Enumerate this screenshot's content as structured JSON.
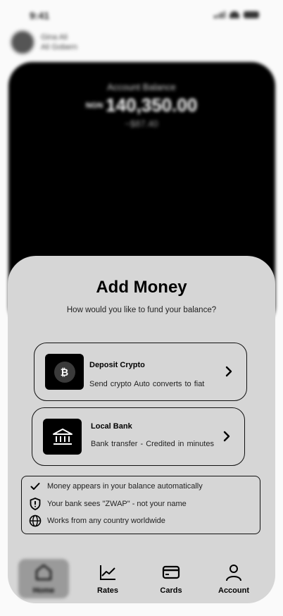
{
  "status": {
    "time": "9:41"
  },
  "user": {
    "line1": "Gina Ali",
    "line2": "Ali Gobern"
  },
  "balance": {
    "label": "Account Balance",
    "currency": "NGN",
    "amount": "140,350.00",
    "usd": "~$87.40"
  },
  "sheet": {
    "title": "Add Money",
    "subtitle": "How would you like to fund your balance?",
    "options": [
      {
        "title": "Deposit Crypto",
        "description": "Send crypto  Auto converts to fiat",
        "icon": "bitcoin-icon"
      },
      {
        "title": "Local Bank",
        "description": "Bank transfer - Credited in minutes",
        "icon": "bank-icon"
      }
    ],
    "info": [
      {
        "icon": "check-icon",
        "text": "Money appears in your balance automatically"
      },
      {
        "icon": "shield-icon",
        "text": "Your bank sees \"ZWAP\" - not your name"
      },
      {
        "icon": "globe-icon",
        "text": "Works from any country worldwide"
      }
    ]
  },
  "tabs": [
    {
      "label": "Home",
      "icon": "home-icon"
    },
    {
      "label": "Rates",
      "icon": "chart-icon"
    },
    {
      "label": "Cards",
      "icon": "card-icon"
    },
    {
      "label": "Account",
      "icon": "person-icon"
    }
  ],
  "colors": {
    "sheet": "#d6d6d6",
    "card": "#000000",
    "background": "#fafafa"
  }
}
